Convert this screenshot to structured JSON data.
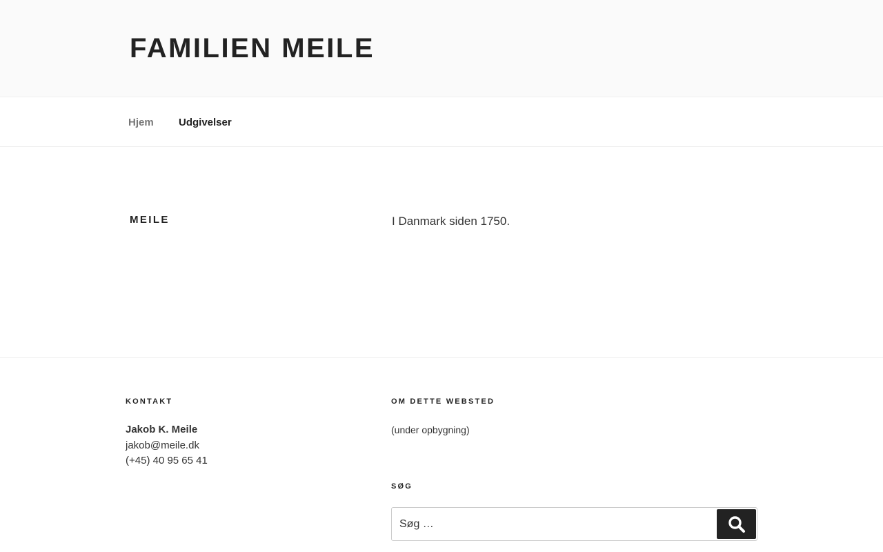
{
  "site": {
    "title": "FAMILIEN MEILE"
  },
  "nav": {
    "items": [
      {
        "label": "Hjem"
      },
      {
        "label": "Udgivelser"
      }
    ]
  },
  "main": {
    "title": "MEILE",
    "text": "I Danmark siden 1750."
  },
  "footer": {
    "contact": {
      "heading": "KONTAKT",
      "name": "Jakob K. Meile",
      "email": "jakob@meile.dk",
      "phone": "(+45) 40 95 65 41"
    },
    "about": {
      "heading": "OM DETTE WEBSTED",
      "text": "(under opbygning)"
    },
    "search": {
      "heading": "SØG",
      "placeholder": "Søg …",
      "button_icon": "search-icon"
    }
  }
}
